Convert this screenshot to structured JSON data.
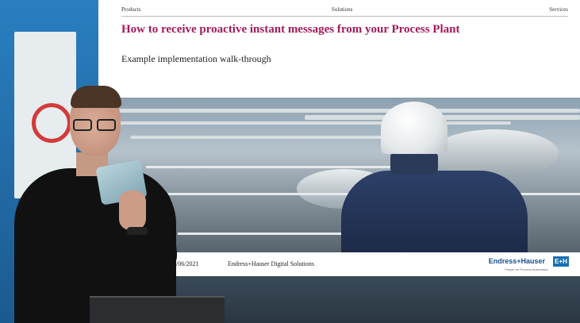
{
  "slide": {
    "nav": {
      "item1": "Products",
      "item2": "Solutions",
      "item3": "Services"
    },
    "title": "How to receive proactive instant messages from your Process Plant",
    "subtitle": "Example implementation walk-through",
    "footer": {
      "date": "/06/2021",
      "company": "Endress+Hauser Digital Solutions",
      "logo_text": "Endress+Hauser",
      "logo_mark": "E+H",
      "tagline": "People for Process Automation"
    }
  },
  "colors": {
    "title": "#a3195b",
    "brand_blue": "#1a6fb4"
  }
}
